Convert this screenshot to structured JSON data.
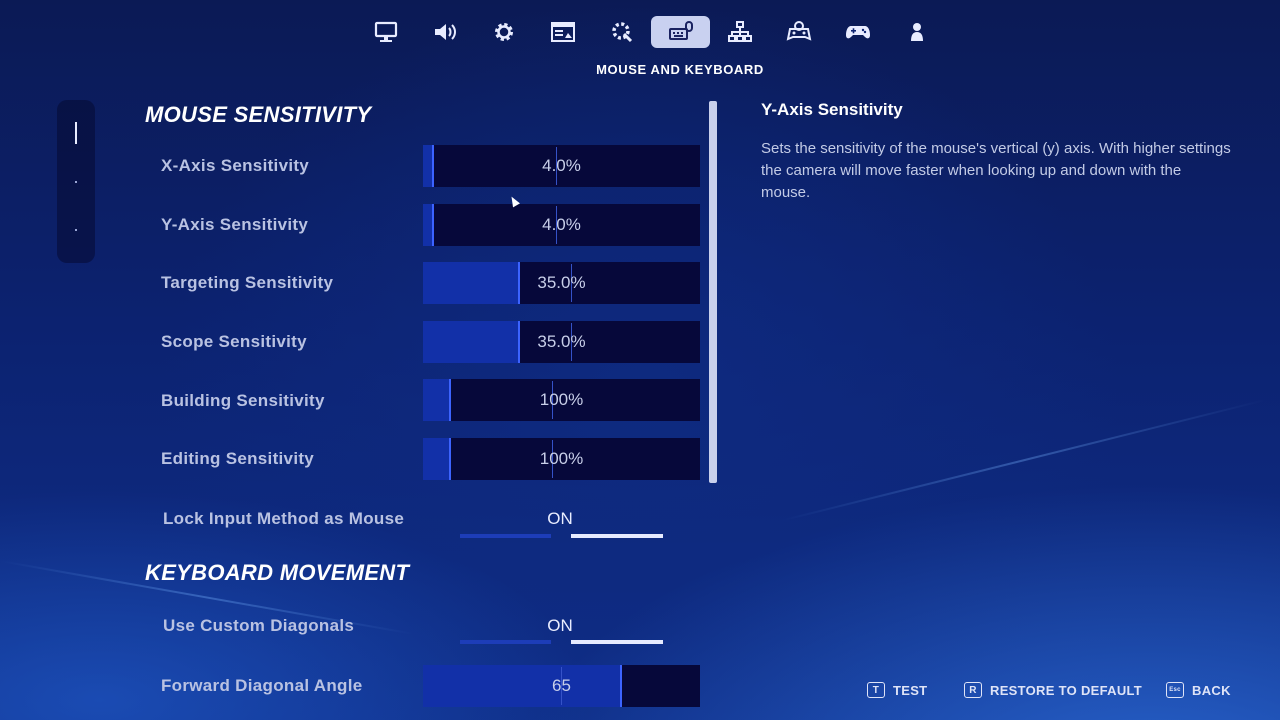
{
  "nav": {
    "tabs": [
      {
        "icon": "monitor-icon",
        "active": false
      },
      {
        "icon": "speaker-icon",
        "active": false
      },
      {
        "icon": "gear-icon",
        "active": false
      },
      {
        "icon": "display-window-icon",
        "active": false
      },
      {
        "icon": "accessibility-gear-icon",
        "active": false
      },
      {
        "icon": "keyboard-mouse-icon",
        "active": true
      },
      {
        "icon": "network-icon",
        "active": false
      },
      {
        "icon": "controller-gear-icon",
        "active": false
      },
      {
        "icon": "gamepad-icon",
        "active": false
      },
      {
        "icon": "account-icon",
        "active": false
      }
    ],
    "section_title": "MOUSE AND KEYBOARD"
  },
  "sections": {
    "mouse_heading": "MOUSE SENSITIVITY",
    "keyboard_heading": "KEYBOARD MOVEMENT"
  },
  "settings": {
    "x_axis": {
      "label": "X-Axis Sensitivity",
      "value": "4.0%",
      "fill": 0.04
    },
    "y_axis": {
      "label": "Y-Axis Sensitivity",
      "value": "4.0%",
      "fill": 0.04
    },
    "targeting": {
      "label": "Targeting Sensitivity",
      "value": "35.0%",
      "fill": 0.35
    },
    "scope": {
      "label": "Scope Sensitivity",
      "value": "35.0%",
      "fill": 0.35
    },
    "building": {
      "label": "Building Sensitivity",
      "value": "100%",
      "fill": 0.1
    },
    "editing": {
      "label": "Editing Sensitivity",
      "value": "100%",
      "fill": 0.1
    },
    "lock_input": {
      "label": "Lock Input Method as Mouse",
      "value": "ON"
    },
    "custom_diagonals": {
      "label": "Use Custom Diagonals",
      "value": "ON"
    },
    "forward_diagonal": {
      "label": "Forward Diagonal Angle",
      "value": "65",
      "fill": 0.72
    }
  },
  "description": {
    "title": "Y-Axis Sensitivity",
    "text": "Sets the sensitivity of the mouse's vertical (y) axis. With higher settings the camera will move faster when looking up and down with the mouse."
  },
  "actions": {
    "test": {
      "key": "T",
      "label": "TEST"
    },
    "restore": {
      "key": "R",
      "label": "RESTORE TO DEFAULT"
    },
    "back": {
      "key": "Esc",
      "label": "BACK"
    }
  },
  "colors": {
    "background": "#0c2270",
    "slider_track": "#06083a",
    "slider_fill": "#1230a8",
    "accent": "#3c63ff",
    "active_tab": "#c9d1f0"
  }
}
